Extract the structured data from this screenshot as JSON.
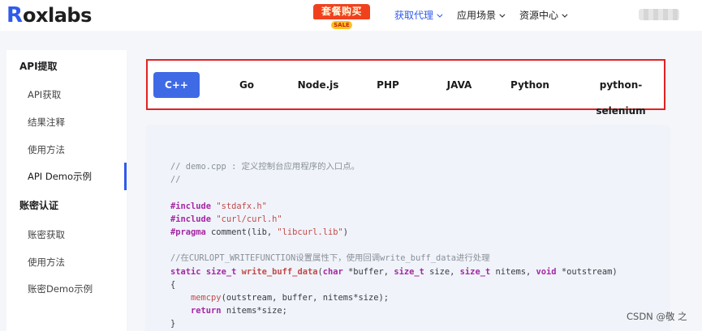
{
  "header": {
    "logo_first": "R",
    "logo_rest": "oxlabs",
    "promo_label": "套餐购买",
    "promo_sale": "SALE",
    "nav": [
      {
        "label": "获取代理",
        "active": true
      },
      {
        "label": "应用场景",
        "active": false
      },
      {
        "label": "资源中心",
        "active": false
      }
    ]
  },
  "sidebar": {
    "groups": [
      {
        "title": "API提取",
        "items": [
          "API获取",
          "结果注释",
          "使用方法",
          "API Demo示例"
        ]
      },
      {
        "title": "账密认证",
        "items": [
          "账密获取",
          "使用方法",
          "账密Demo示例"
        ]
      }
    ],
    "active_item": "API Demo示例"
  },
  "tabs": {
    "items": [
      "C++",
      "Go",
      "Node.js",
      "PHP",
      "JAVA",
      "Python",
      "python-selenium"
    ],
    "active": "C++"
  },
  "code": {
    "lines": [
      "// demo.cpp : 定义控制台应用程序的入口点。",
      "//",
      "",
      "#include \"stdafx.h\"",
      "#include \"curl/curl.h\"",
      "#pragma comment(lib, \"libcurl.lib\")",
      "",
      "//在CURLOPT_WRITEFUNCTION设置属性下，使用回调write_buff_data进行处理",
      "static size_t write_buff_data(char *buffer, size_t size, size_t nitems, void *outstream)",
      "{",
      "    memcpy(outstream, buffer, nitems*size);",
      "    return nitems*size;",
      "}"
    ]
  },
  "watermark": "CSDN @敬 之",
  "colors": {
    "brand_blue": "#2f5bea",
    "active_tab": "#3f6ae6",
    "highlight_border": "#e22222",
    "promo_red": "#f0411e"
  }
}
